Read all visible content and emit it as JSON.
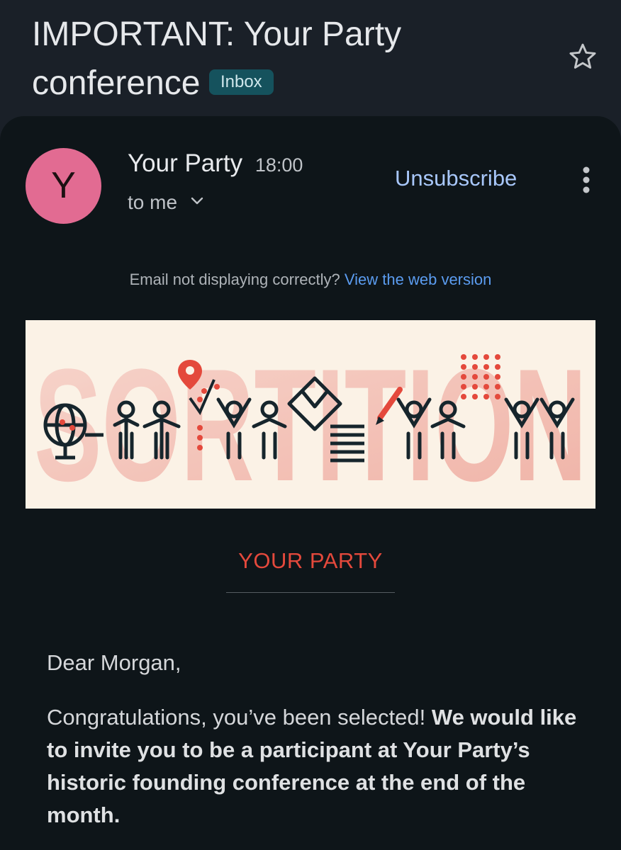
{
  "header": {
    "subject": "IMPORTANT: Your Party conference",
    "label_chip": "Inbox",
    "star_icon": "star-outline-icon"
  },
  "message": {
    "sender_initial": "Y",
    "sender_name": "Your Party",
    "time": "18:00",
    "recipient": "to me",
    "unsubscribe_label": "Unsubscribe",
    "more_icon": "more-vert-icon"
  },
  "email_body": {
    "notice_text": "Email not displaying correctly?",
    "notice_link": "View the web version",
    "banner_text": "SORTITION",
    "brand_heading": "YOUR PARTY",
    "greeting": "Dear Morgan,",
    "para_intro": "Congratulations, you’ve been selected!",
    "para_bold": "We would like to invite you to be a participant at Your Party’s historic founding conference at the end of the month."
  },
  "colors": {
    "background": "#1a2028",
    "card": "#0e1519",
    "avatar": "#e26b92",
    "link": "#a8c7fa",
    "brand_red": "#e4493c",
    "chip": "#15525d"
  }
}
